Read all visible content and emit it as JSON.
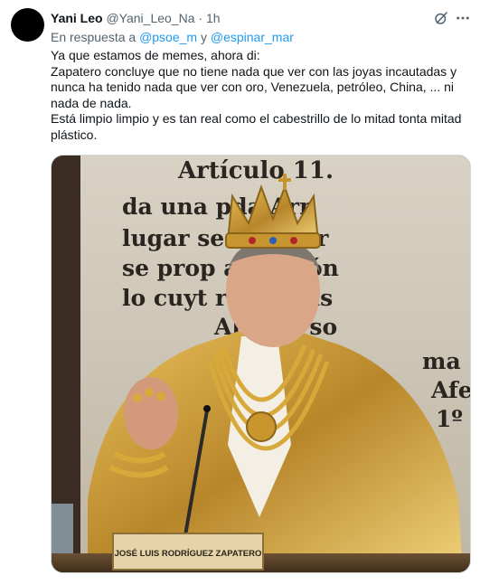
{
  "tweet": {
    "author_name": "Yani Leo",
    "author_handle": "@Yani_Leo_Na",
    "separator": "·",
    "time": "1h",
    "reply_prefix": "En respuesta a",
    "reply_mention_1": "@psoe_m",
    "reply_joiner": "y",
    "reply_mention_2": "@espinar_mar",
    "text_lines": [
      "Ya que estamos de memes, ahora di:",
      "Zapatero concluye que no tiene nada que ver con las joyas incautadas y",
      "nunca ha tenido nada que ver con  oro, Venezuela, petróleo, China, ... ni",
      "nada de nada.",
      "Está limpio limpio y es tan real como el cabestrillo de lo mitad tonta mitad",
      "plástico."
    ],
    "icons": {
      "grok": "grok-icon",
      "more": "more-options-icon"
    },
    "colors": {
      "text": "#0f1419",
      "secondary": "#536471",
      "link": "#1d9bf0"
    }
  },
  "media": {
    "wall_lines": [
      "Artículo 11.",
      "da una   pda Arn",
      "lugar se    ble. For",
      "se prop    a adición",
      "lo cuyt   ro habías",
      "Ale    bia so",
      "ma",
      "Afe",
      "1º"
    ],
    "placard": "JOSÉ LUIS RODRÍGUEZ ZAPATERO"
  }
}
